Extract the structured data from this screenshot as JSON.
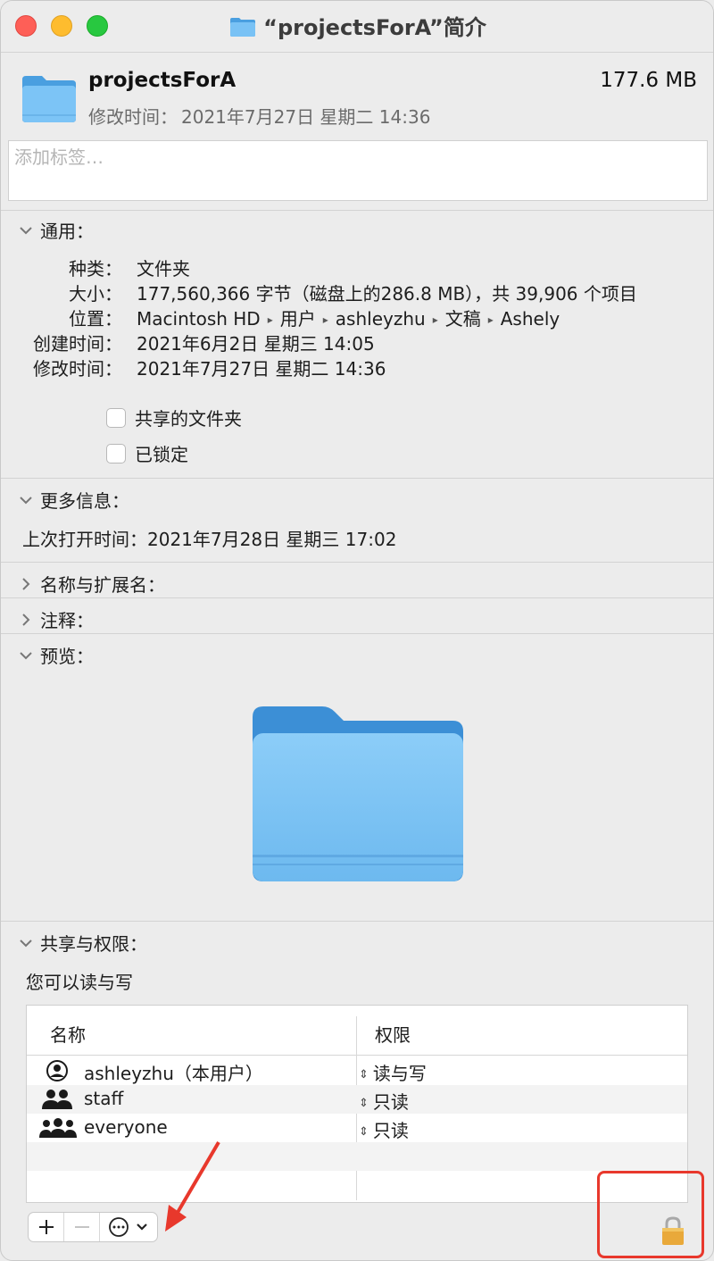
{
  "window": {
    "title": "“projectsForA”简介"
  },
  "header": {
    "name": "projectsForA",
    "size": "177.6 MB",
    "modified_label": "修改时间：",
    "modified_value": "2021年7月27日 星期二 14:36"
  },
  "tags": {
    "placeholder": "添加标签…"
  },
  "general": {
    "title": "通用：",
    "kind_label": "种类：",
    "kind_value": "文件夹",
    "size_label": "大小：",
    "size_value": "177,560,366 字节（磁盘上的286.8 MB），共 39,906 个项目",
    "where_label": "位置：",
    "where_path": [
      "Macintosh HD",
      "用户",
      "ashleyzhu",
      "文稿",
      "Ashely"
    ],
    "created_label": "创建时间：",
    "created_value": "2021年6月2日 星期三 14:05",
    "modified_label": "修改时间：",
    "modified_value": "2021年7月27日 星期二 14:36",
    "shared_label": "共享的文件夹",
    "locked_label": "已锁定"
  },
  "more_info": {
    "title": "更多信息：",
    "last_opened_label": "上次打开时间：",
    "last_opened_value": "2021年7月28日 星期三 17:02"
  },
  "name_ext": {
    "title": "名称与扩展名："
  },
  "comments": {
    "title": "注释："
  },
  "preview": {
    "title": "预览："
  },
  "sharing": {
    "title": "共享与权限：",
    "status": "您可以读与写",
    "col_name": "名称",
    "col_priv": "权限",
    "rows": [
      {
        "name": "ashleyzhu（本用户）",
        "priv": "读与写",
        "icon": "user-icon"
      },
      {
        "name": "staff",
        "priv": "只读",
        "icon": "group-icon"
      },
      {
        "name": "everyone",
        "priv": "只读",
        "icon": "everyone-icon"
      }
    ]
  },
  "colors": {
    "folder_blue": "#70bdf2",
    "annotation_red": "#e8382c"
  }
}
